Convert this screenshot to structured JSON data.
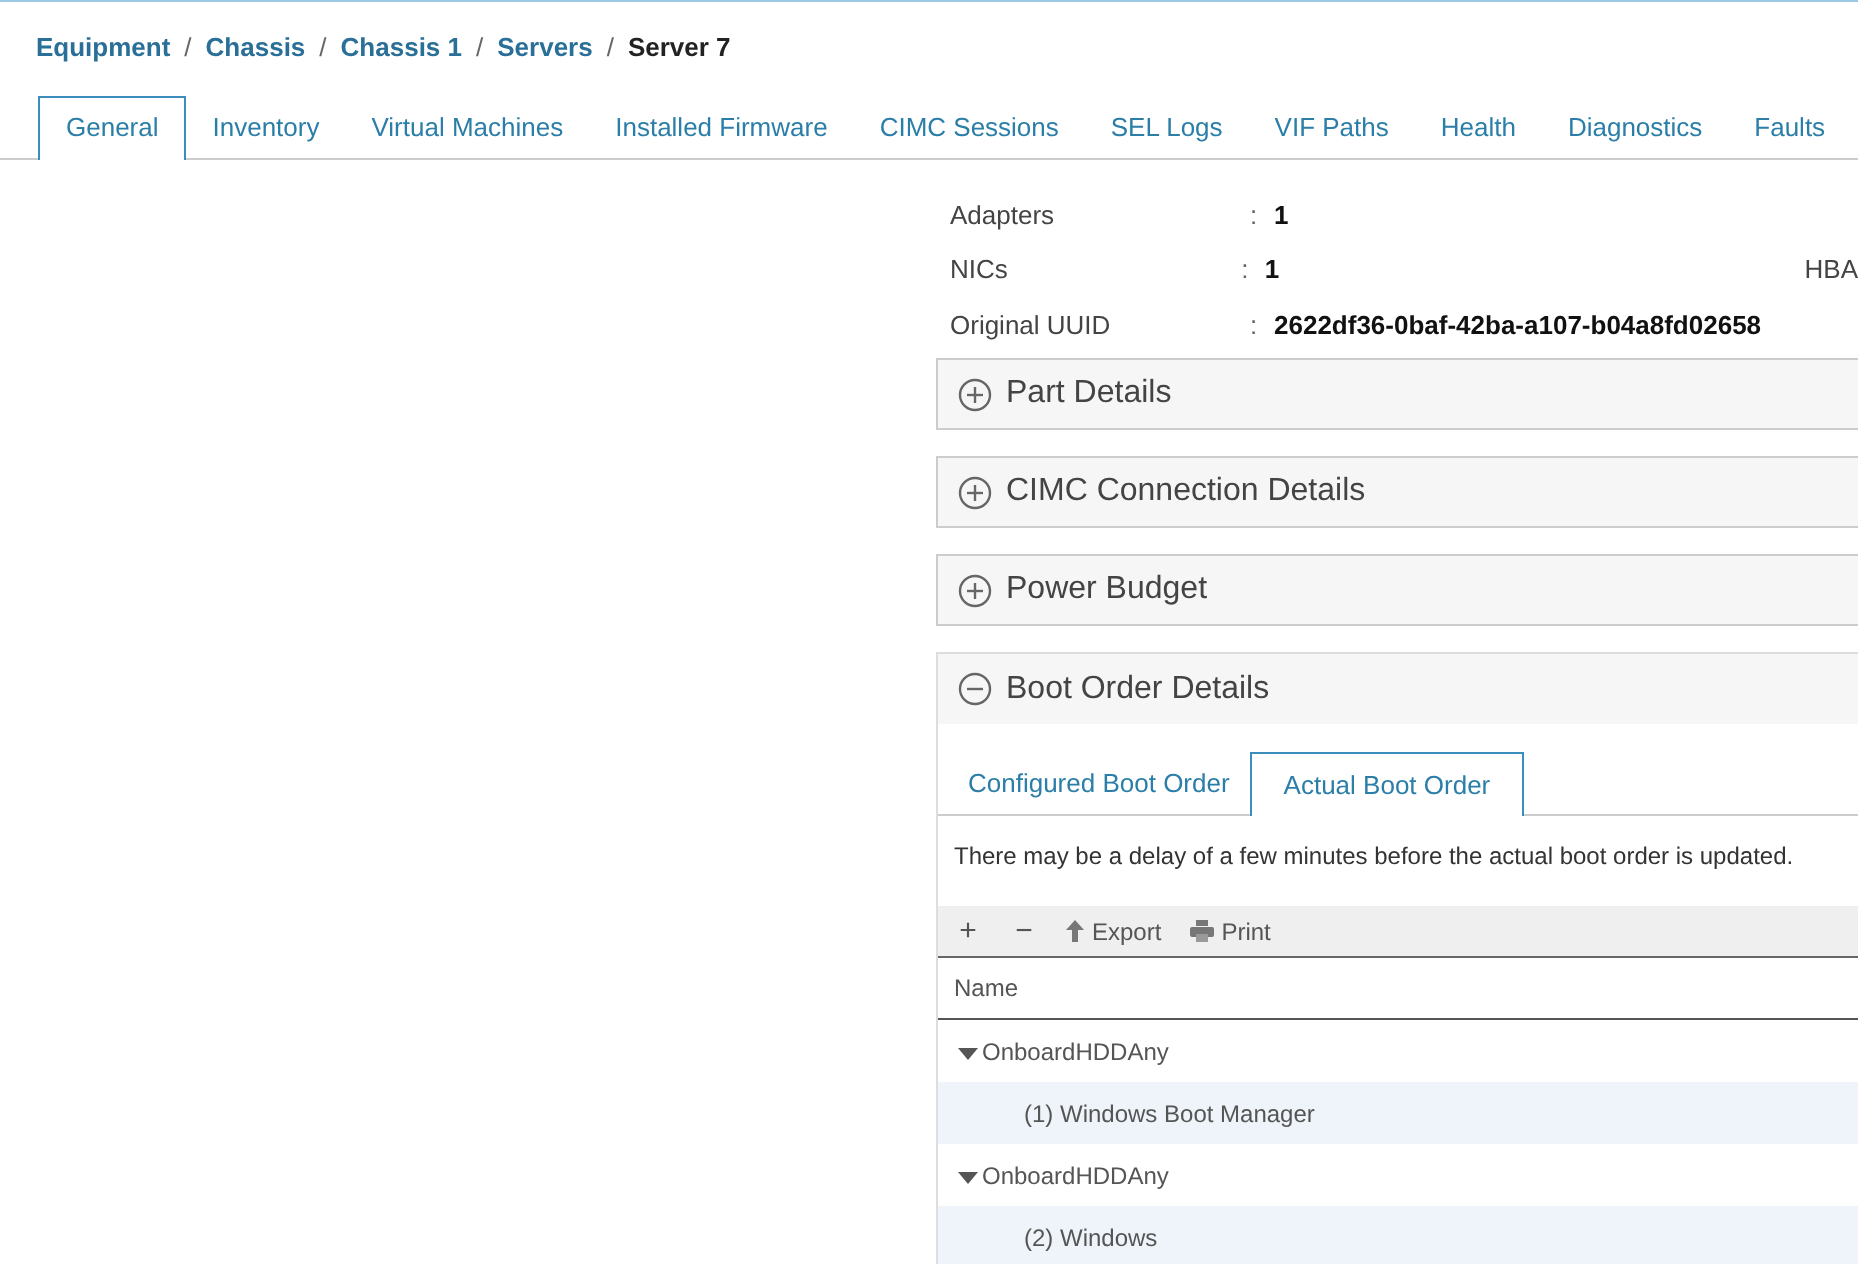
{
  "breadcrumb": [
    {
      "label": "Equipment",
      "kind": "link"
    },
    {
      "label": "/",
      "kind": "separator"
    },
    {
      "label": "Chassis",
      "kind": "link"
    },
    {
      "label": "/",
      "kind": "separator"
    },
    {
      "label": "Chassis 1",
      "kind": "link"
    },
    {
      "label": "/",
      "kind": "separator"
    },
    {
      "label": "Servers",
      "kind": "link"
    },
    {
      "label": "/",
      "kind": "separator"
    },
    {
      "label": "Server 7",
      "kind": "current"
    }
  ],
  "tabs": [
    {
      "label": "General",
      "selected": true
    },
    {
      "label": "Inventory",
      "selected": false
    },
    {
      "label": "Virtual Machines",
      "selected": false
    },
    {
      "label": "Installed Firmware",
      "selected": false
    },
    {
      "label": "CIMC Sessions",
      "selected": false
    },
    {
      "label": "SEL Logs",
      "selected": false
    },
    {
      "label": "VIF Paths",
      "selected": false
    },
    {
      "label": "Health",
      "selected": false
    },
    {
      "label": "Diagnostics",
      "selected": false
    },
    {
      "label": "Faults",
      "selected": false
    }
  ],
  "properties": [
    {
      "label": "Adapters",
      "colon": ":",
      "value": "1"
    },
    {
      "label": "NICs",
      "colon": ":",
      "value": "1",
      "right_label": "HBA"
    },
    {
      "label": "Original UUID",
      "colon": ":",
      "value": "2622df36-0baf-42ba-a107-b04a8fd02658"
    }
  ],
  "sections": [
    {
      "title": "Part Details",
      "expanded": false
    },
    {
      "title": "CIMC Connection Details",
      "expanded": false
    },
    {
      "title": "Power Budget",
      "expanded": false
    },
    {
      "title": "Boot Order Details",
      "expanded": true
    }
  ],
  "boot_order": {
    "tabs": [
      {
        "label": "Configured Boot Order",
        "selected": false
      },
      {
        "label": "Actual Boot Order",
        "selected": true
      }
    ],
    "message": "There may be a delay of a few minutes before the actual boot order is updated.",
    "toolbar": [
      {
        "kind": "add",
        "label": "+"
      },
      {
        "kind": "remove",
        "label": "−"
      },
      {
        "kind": "export",
        "label": "Export"
      },
      {
        "kind": "print",
        "label": "Print"
      }
    ],
    "table": {
      "columns": [
        "Name"
      ],
      "rows": [
        {
          "name": "OnboardHDDAny",
          "expanded": true,
          "children": [
            {
              "name": "(1) Windows Boot Manager"
            }
          ]
        },
        {
          "name": "OnboardHDDAny",
          "expanded": true,
          "children": [
            {
              "name": "(2) Windows"
            }
          ]
        }
      ]
    }
  }
}
